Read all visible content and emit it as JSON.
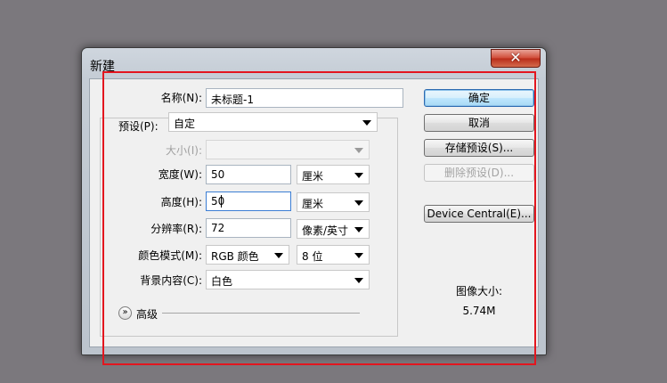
{
  "dialog": {
    "title": "新建",
    "close_glyph": "✕",
    "name": {
      "label": "名称(N):",
      "value": "未标题-1"
    },
    "preset": {
      "label": "预设(P):",
      "value": "自定"
    },
    "size": {
      "label": "大小(I):",
      "value": ""
    },
    "width": {
      "label": "宽度(W):",
      "value": "50",
      "unit": "厘米"
    },
    "height": {
      "label": "高度(H):",
      "value": "50",
      "unit": "厘米"
    },
    "resolution": {
      "label": "分辨率(R):",
      "value": "72",
      "unit": "像素/英寸"
    },
    "color_mode": {
      "label": "颜色模式(M):",
      "mode": "RGB 颜色",
      "depth": "8 位"
    },
    "background": {
      "label": "背景内容(C):",
      "value": "白色"
    },
    "advanced": {
      "label": "高级",
      "icon": "double-chevron-down-icon"
    },
    "buttons": {
      "ok": "确定",
      "cancel": "取消",
      "save_preset": "存储预设(S)...",
      "delete_preset": "删除预设(D)...",
      "device_central": "Device Central(E)..."
    },
    "image_size": {
      "label": "图像大小:",
      "value": "5.74M"
    }
  },
  "colors": {
    "annotation": "#e3161f",
    "desktop": "#7b787d",
    "close_button": "#c8381f"
  }
}
